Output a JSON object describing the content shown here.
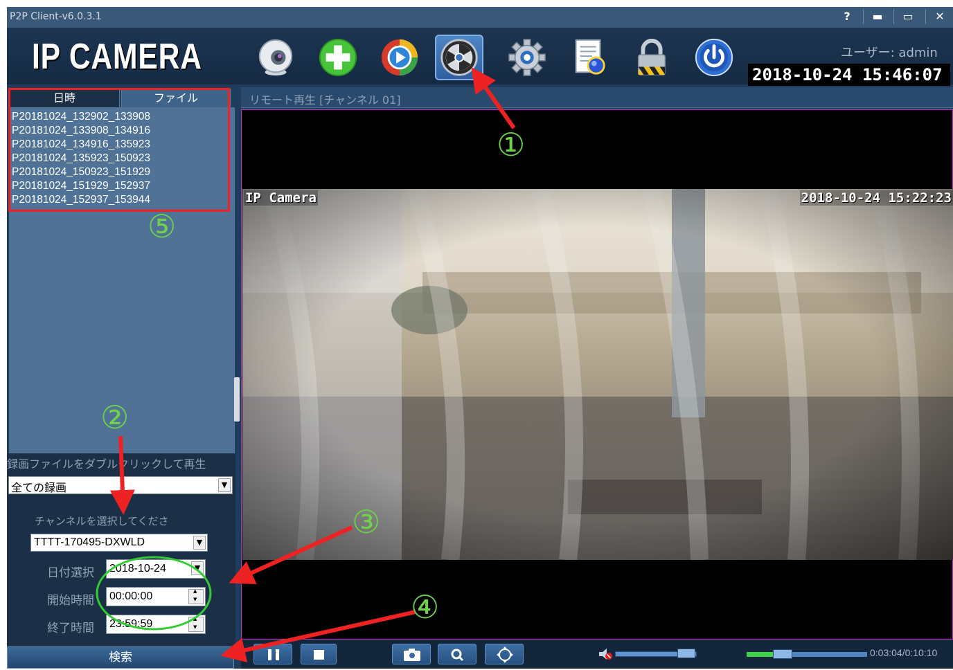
{
  "window": {
    "title": "P2P Client-v6.0.3.1",
    "help_label": "?",
    "minimize_label": "▬",
    "maximize_label": "▭",
    "close_label": "✕"
  },
  "toolbar": {
    "logo": "IP CAMERA",
    "user_line": "ユーザー: admin",
    "clock": "2018-10-24 15:46:07",
    "icons": [
      "webcam-icon",
      "add-device-icon",
      "live-play-icon",
      "playback-reel-icon",
      "settings-gear-icon",
      "log-document-icon",
      "lock-icon",
      "power-icon"
    ]
  },
  "left_panel": {
    "tab_datetime": "日時",
    "tab_file": "ファイル",
    "files": [
      "P20181024_132902_133908",
      "P20181024_133908_134916",
      "P20181024_134916_135923",
      "P20181024_135923_150923",
      "P20181024_150923_151929",
      "P20181024_151929_152937",
      "P20181024_152937_153944"
    ],
    "hint": "録画ファイルをダブルクリックして再生",
    "record_type": "全ての録画",
    "channel_label": "チャンネルを選択してくださ",
    "channel_value": "TTTT-170495-DXWLD",
    "date_label": "日付選択",
    "date_value": "2018-10-24",
    "start_label": "開始時間",
    "start_value": "00:00:00",
    "end_label": "終了時間",
    "end_value": "23:59:59",
    "search_label": "検索"
  },
  "video": {
    "header": "リモート再生 [チャンネル 01]",
    "osd_name": "IP Camera",
    "osd_time": "2018-10-24 15:22:23",
    "border_color": "#c22bc6"
  },
  "controls": {
    "time": "0:03:04/0:10:10",
    "volume": 0.8,
    "progress": 0.3
  },
  "annotations": {
    "n1": "①",
    "n2": "②",
    "n3": "③",
    "n4": "④",
    "n5": "⑤",
    "color": "#ee2222"
  }
}
